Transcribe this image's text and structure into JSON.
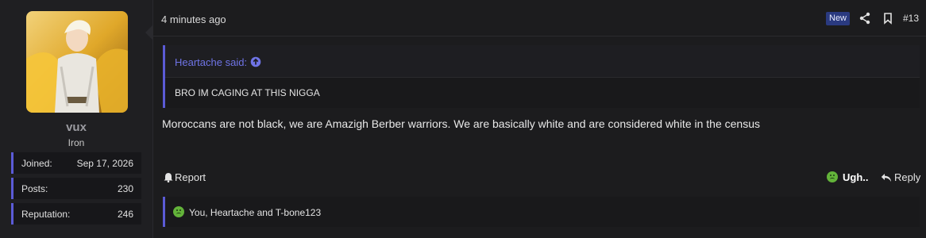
{
  "user": {
    "name": "vux",
    "title": "Iron",
    "stats": [
      {
        "label": "Joined:",
        "value": "Sep 17, 2026"
      },
      {
        "label": "Posts:",
        "value": "230"
      },
      {
        "label": "Reputation:",
        "value": "246"
      }
    ]
  },
  "header": {
    "time": "4 minutes ago",
    "badge": "New",
    "post_number": "#13"
  },
  "quote": {
    "author": "Heartache said:",
    "text": "BRO IM CAGING AT THIS NIGGA"
  },
  "message": "Moroccans are not black, we are Amazigh Berber warriors. We are basically white and are considered white in the census",
  "footer": {
    "report": "Report",
    "reaction": "Ugh..",
    "reply": "Reply"
  },
  "reactions_summary": "You, Heartache and T-bone123",
  "colors": {
    "accent": "#5b5bd6",
    "reaction_face": "#63b33a",
    "badge_bg": "#2a3a80"
  }
}
